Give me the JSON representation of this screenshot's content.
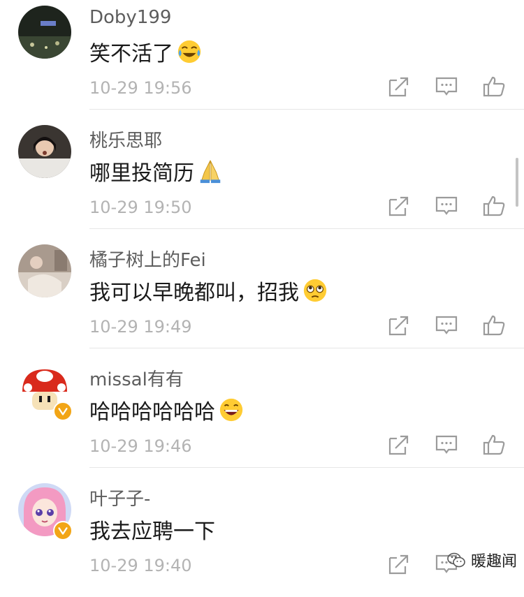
{
  "comments": [
    {
      "username": "Doby199",
      "text": "笑不活了",
      "emoji": "tears-of-joy-emoji",
      "time": "10-29 19:56",
      "verified": false
    },
    {
      "username": "桃乐思耶",
      "text": "哪里投简历",
      "emoji": "folded-hands-emoji",
      "time": "10-29 19:50",
      "verified": false
    },
    {
      "username": "橘子树上的Fei",
      "text": "我可以早晚都叫，招我",
      "emoji": "pleading-face-emoji",
      "time": "10-29 19:49",
      "verified": false
    },
    {
      "username": "missal有有",
      "text": "哈哈哈哈哈哈",
      "emoji": "grinning-face-emoji",
      "time": "10-29 19:46",
      "verified": true
    },
    {
      "username": "叶子子-",
      "text": "我去应聘一下",
      "emoji": "",
      "time": "10-29 19:40",
      "verified": true
    }
  ],
  "actions": {
    "share_icon": "share-icon",
    "reply_icon": "comment-icon",
    "like_icon": "thumbs-up-icon"
  },
  "watermark": {
    "text": "暖趣闻",
    "icon": "wechat-icon"
  },
  "colors": {
    "username": "#5d5d5d",
    "text": "#1a1a1a",
    "time": "#b3b3b3",
    "divider": "#e6e6e6",
    "verified": "#f2a516"
  }
}
